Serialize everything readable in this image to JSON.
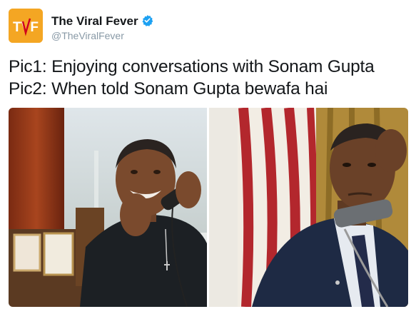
{
  "author": {
    "name": "The Viral Fever",
    "handle": "@TheViralFever",
    "avatar_text": "TVF",
    "avatar_color": "#f4a623",
    "verified": true,
    "verified_icon": "verified-badge-icon"
  },
  "tweet": {
    "lines": [
      "Pic1: Enjoying conversations with Sonam Gupta",
      "Pic2: When told Sonam Gupta bewafa hai"
    ]
  },
  "media": {
    "photos": [
      {
        "description_icon": "photo-man-laughing-on-phone"
      },
      {
        "description_icon": "photo-man-serious-on-phone"
      }
    ]
  },
  "colors": {
    "text": "#14171a",
    "handle": "#8899a6",
    "verified": "#1da1f2"
  }
}
